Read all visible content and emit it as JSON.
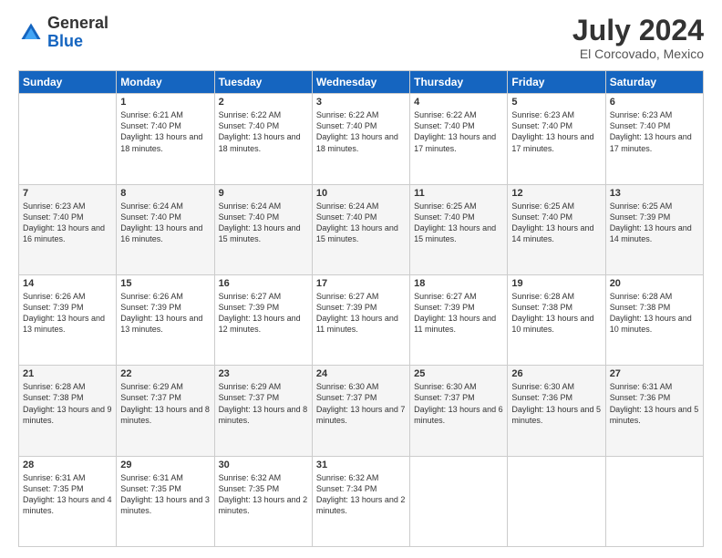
{
  "logo": {
    "general": "General",
    "blue": "Blue"
  },
  "header": {
    "month_year": "July 2024",
    "location": "El Corcovado, Mexico"
  },
  "weekdays": [
    "Sunday",
    "Monday",
    "Tuesday",
    "Wednesday",
    "Thursday",
    "Friday",
    "Saturday"
  ],
  "weeks": [
    [
      {
        "day": "",
        "sunrise": "",
        "sunset": "",
        "daylight": ""
      },
      {
        "day": "1",
        "sunrise": "Sunrise: 6:21 AM",
        "sunset": "Sunset: 7:40 PM",
        "daylight": "Daylight: 13 hours and 18 minutes."
      },
      {
        "day": "2",
        "sunrise": "Sunrise: 6:22 AM",
        "sunset": "Sunset: 7:40 PM",
        "daylight": "Daylight: 13 hours and 18 minutes."
      },
      {
        "day": "3",
        "sunrise": "Sunrise: 6:22 AM",
        "sunset": "Sunset: 7:40 PM",
        "daylight": "Daylight: 13 hours and 18 minutes."
      },
      {
        "day": "4",
        "sunrise": "Sunrise: 6:22 AM",
        "sunset": "Sunset: 7:40 PM",
        "daylight": "Daylight: 13 hours and 17 minutes."
      },
      {
        "day": "5",
        "sunrise": "Sunrise: 6:23 AM",
        "sunset": "Sunset: 7:40 PM",
        "daylight": "Daylight: 13 hours and 17 minutes."
      },
      {
        "day": "6",
        "sunrise": "Sunrise: 6:23 AM",
        "sunset": "Sunset: 7:40 PM",
        "daylight": "Daylight: 13 hours and 17 minutes."
      }
    ],
    [
      {
        "day": "7",
        "sunrise": "Sunrise: 6:23 AM",
        "sunset": "Sunset: 7:40 PM",
        "daylight": "Daylight: 13 hours and 16 minutes."
      },
      {
        "day": "8",
        "sunrise": "Sunrise: 6:24 AM",
        "sunset": "Sunset: 7:40 PM",
        "daylight": "Daylight: 13 hours and 16 minutes."
      },
      {
        "day": "9",
        "sunrise": "Sunrise: 6:24 AM",
        "sunset": "Sunset: 7:40 PM",
        "daylight": "Daylight: 13 hours and 15 minutes."
      },
      {
        "day": "10",
        "sunrise": "Sunrise: 6:24 AM",
        "sunset": "Sunset: 7:40 PM",
        "daylight": "Daylight: 13 hours and 15 minutes."
      },
      {
        "day": "11",
        "sunrise": "Sunrise: 6:25 AM",
        "sunset": "Sunset: 7:40 PM",
        "daylight": "Daylight: 13 hours and 15 minutes."
      },
      {
        "day": "12",
        "sunrise": "Sunrise: 6:25 AM",
        "sunset": "Sunset: 7:40 PM",
        "daylight": "Daylight: 13 hours and 14 minutes."
      },
      {
        "day": "13",
        "sunrise": "Sunrise: 6:25 AM",
        "sunset": "Sunset: 7:39 PM",
        "daylight": "Daylight: 13 hours and 14 minutes."
      }
    ],
    [
      {
        "day": "14",
        "sunrise": "Sunrise: 6:26 AM",
        "sunset": "Sunset: 7:39 PM",
        "daylight": "Daylight: 13 hours and 13 minutes."
      },
      {
        "day": "15",
        "sunrise": "Sunrise: 6:26 AM",
        "sunset": "Sunset: 7:39 PM",
        "daylight": "Daylight: 13 hours and 13 minutes."
      },
      {
        "day": "16",
        "sunrise": "Sunrise: 6:27 AM",
        "sunset": "Sunset: 7:39 PM",
        "daylight": "Daylight: 13 hours and 12 minutes."
      },
      {
        "day": "17",
        "sunrise": "Sunrise: 6:27 AM",
        "sunset": "Sunset: 7:39 PM",
        "daylight": "Daylight: 13 hours and 11 minutes."
      },
      {
        "day": "18",
        "sunrise": "Sunrise: 6:27 AM",
        "sunset": "Sunset: 7:39 PM",
        "daylight": "Daylight: 13 hours and 11 minutes."
      },
      {
        "day": "19",
        "sunrise": "Sunrise: 6:28 AM",
        "sunset": "Sunset: 7:38 PM",
        "daylight": "Daylight: 13 hours and 10 minutes."
      },
      {
        "day": "20",
        "sunrise": "Sunrise: 6:28 AM",
        "sunset": "Sunset: 7:38 PM",
        "daylight": "Daylight: 13 hours and 10 minutes."
      }
    ],
    [
      {
        "day": "21",
        "sunrise": "Sunrise: 6:28 AM",
        "sunset": "Sunset: 7:38 PM",
        "daylight": "Daylight: 13 hours and 9 minutes."
      },
      {
        "day": "22",
        "sunrise": "Sunrise: 6:29 AM",
        "sunset": "Sunset: 7:37 PM",
        "daylight": "Daylight: 13 hours and 8 minutes."
      },
      {
        "day": "23",
        "sunrise": "Sunrise: 6:29 AM",
        "sunset": "Sunset: 7:37 PM",
        "daylight": "Daylight: 13 hours and 8 minutes."
      },
      {
        "day": "24",
        "sunrise": "Sunrise: 6:30 AM",
        "sunset": "Sunset: 7:37 PM",
        "daylight": "Daylight: 13 hours and 7 minutes."
      },
      {
        "day": "25",
        "sunrise": "Sunrise: 6:30 AM",
        "sunset": "Sunset: 7:37 PM",
        "daylight": "Daylight: 13 hours and 6 minutes."
      },
      {
        "day": "26",
        "sunrise": "Sunrise: 6:30 AM",
        "sunset": "Sunset: 7:36 PM",
        "daylight": "Daylight: 13 hours and 5 minutes."
      },
      {
        "day": "27",
        "sunrise": "Sunrise: 6:31 AM",
        "sunset": "Sunset: 7:36 PM",
        "daylight": "Daylight: 13 hours and 5 minutes."
      }
    ],
    [
      {
        "day": "28",
        "sunrise": "Sunrise: 6:31 AM",
        "sunset": "Sunset: 7:35 PM",
        "daylight": "Daylight: 13 hours and 4 minutes."
      },
      {
        "day": "29",
        "sunrise": "Sunrise: 6:31 AM",
        "sunset": "Sunset: 7:35 PM",
        "daylight": "Daylight: 13 hours and 3 minutes."
      },
      {
        "day": "30",
        "sunrise": "Sunrise: 6:32 AM",
        "sunset": "Sunset: 7:35 PM",
        "daylight": "Daylight: 13 hours and 2 minutes."
      },
      {
        "day": "31",
        "sunrise": "Sunrise: 6:32 AM",
        "sunset": "Sunset: 7:34 PM",
        "daylight": "Daylight: 13 hours and 2 minutes."
      },
      {
        "day": "",
        "sunrise": "",
        "sunset": "",
        "daylight": ""
      },
      {
        "day": "",
        "sunrise": "",
        "sunset": "",
        "daylight": ""
      },
      {
        "day": "",
        "sunrise": "",
        "sunset": "",
        "daylight": ""
      }
    ]
  ]
}
